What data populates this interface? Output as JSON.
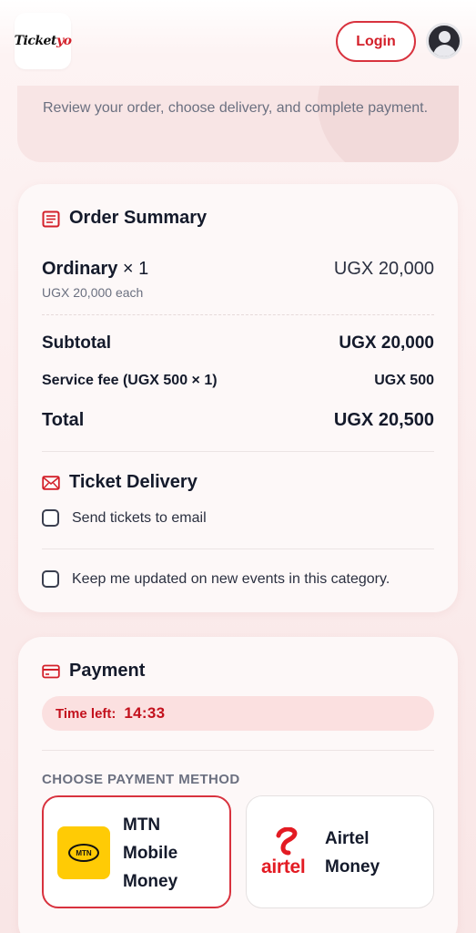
{
  "header": {
    "logo_main": "Ticket",
    "logo_accent": "yo",
    "login_label": "Login"
  },
  "intro": {
    "text": "Review your order, choose delivery, and complete payment."
  },
  "order_summary": {
    "title": "Order Summary",
    "item_name": "Ordinary",
    "item_qty": "× 1",
    "item_each": "UGX 20,000 each",
    "item_price": "UGX 20,000",
    "subtotal_label": "Subtotal",
    "subtotal_value": "UGX 20,000",
    "fee_label": "Service fee (UGX 500 × 1)",
    "fee_value": "UGX 500",
    "total_label": "Total",
    "total_value": "UGX 20,500"
  },
  "delivery": {
    "title": "Ticket Delivery",
    "email_option": "Send tickets to email",
    "updates_option": "Keep me updated on new events in this category."
  },
  "payment": {
    "title": "Payment",
    "timer_label": "Time left:",
    "timer_value": "14:33",
    "method_label": "CHOOSE PAYMENT METHOD",
    "mtn_badge": "MTN",
    "mtn_line1": "MTN",
    "mtn_line2": "Mobile",
    "mtn_line3": "Money",
    "airtel_brand": "airtel",
    "airtel_line1": "Airtel",
    "airtel_line2": "Money"
  },
  "colors": {
    "accent": "#d3202a",
    "mtn_yellow": "#ffcb05",
    "airtel_red": "#e31b23",
    "timer_bg": "#fbe0e0"
  }
}
